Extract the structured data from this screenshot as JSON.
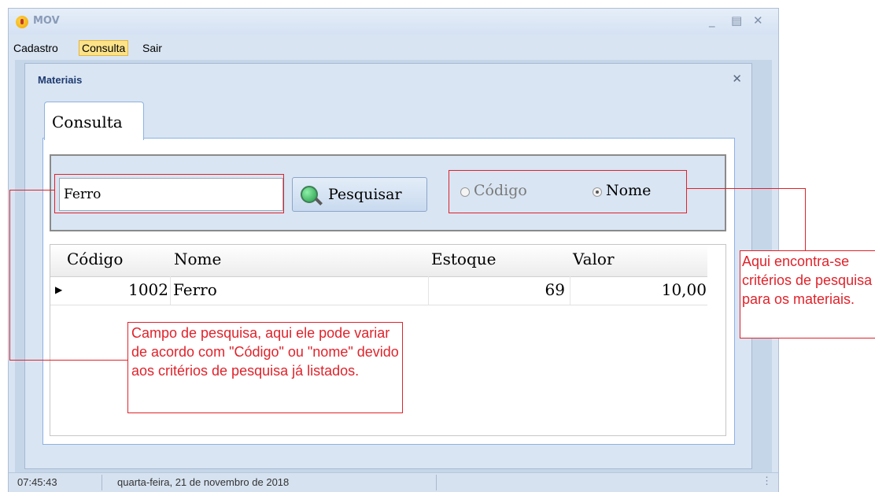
{
  "app": {
    "title": "MOV"
  },
  "menu": {
    "items": [
      "Cadastro",
      "Consulta",
      "Sair"
    ]
  },
  "child_window": {
    "title": "Materiais"
  },
  "tab": {
    "label": "Consulta"
  },
  "search": {
    "value": "Ferro",
    "button_label": "Pesquisar"
  },
  "criteria": {
    "options": [
      "Código",
      "Nome"
    ],
    "selected": "Nome"
  },
  "grid": {
    "columns": [
      "Código",
      "Nome",
      "Estoque",
      "Valor"
    ],
    "rows": [
      {
        "codigo": "1002",
        "nome": "Ferro",
        "estoque": "69",
        "valor": "10,00"
      }
    ]
  },
  "status": {
    "time": "07:45:43",
    "date": "quarta-feira, 21 de novembro de 2018"
  },
  "annotations": {
    "search_field": "Campo de pesquisa, aqui ele pode variar de acordo com \"Código\" ou \"nome\" devido aos critérios de pesquisa já listados.",
    "criteria": "Aqui encontra-se critérios de pesquisa para os materiais."
  },
  "colors": {
    "annotation_red": "#e0232b",
    "menu_highlight": "#fce38a"
  }
}
